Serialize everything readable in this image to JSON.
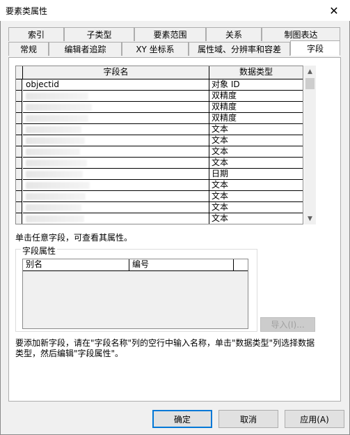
{
  "window": {
    "title": "要素类属性",
    "close_symbol": "✕"
  },
  "tabs_row1": [
    "索引",
    "子类型",
    "要素范围",
    "关系",
    "制图表达"
  ],
  "tabs_row2": [
    "常规",
    "编辑者追踪",
    "XY 坐标系",
    "属性域、分辨率和容差",
    "字段"
  ],
  "active_tab": "字段",
  "fields_table": {
    "headers": {
      "field_name": "字段名",
      "data_type": "数据类型"
    },
    "rows": [
      {
        "name": "objectid",
        "type": "对象 ID"
      },
      {
        "name": "",
        "type": "双精度"
      },
      {
        "name": "",
        "type": "双精度"
      },
      {
        "name": "",
        "type": "双精度"
      },
      {
        "name": "",
        "type": "文本"
      },
      {
        "name": "",
        "type": "文本"
      },
      {
        "name": "",
        "type": "文本"
      },
      {
        "name": "",
        "type": "文本"
      },
      {
        "name": "",
        "type": "日期"
      },
      {
        "name": "",
        "type": "文本"
      },
      {
        "name": "",
        "type": "文本"
      },
      {
        "name": "",
        "type": "文本"
      },
      {
        "name": "",
        "type": "文本"
      }
    ],
    "scroll_up": "▲",
    "scroll_down": "▼"
  },
  "instruction": "单击任意字段，可查看其属性。",
  "field_properties": {
    "title": "字段属性",
    "headers": {
      "alias": "别名",
      "number": "编号"
    }
  },
  "import_button": "导入(I)...",
  "hint": "要添加新字段，请在\"字段名称\"列的空行中输入名称，单击\"数据类型\"列选择数据类型，然后编辑\"字段属性\"。",
  "buttons": {
    "ok": "确定",
    "cancel": "取消",
    "apply": "应用(A)"
  }
}
